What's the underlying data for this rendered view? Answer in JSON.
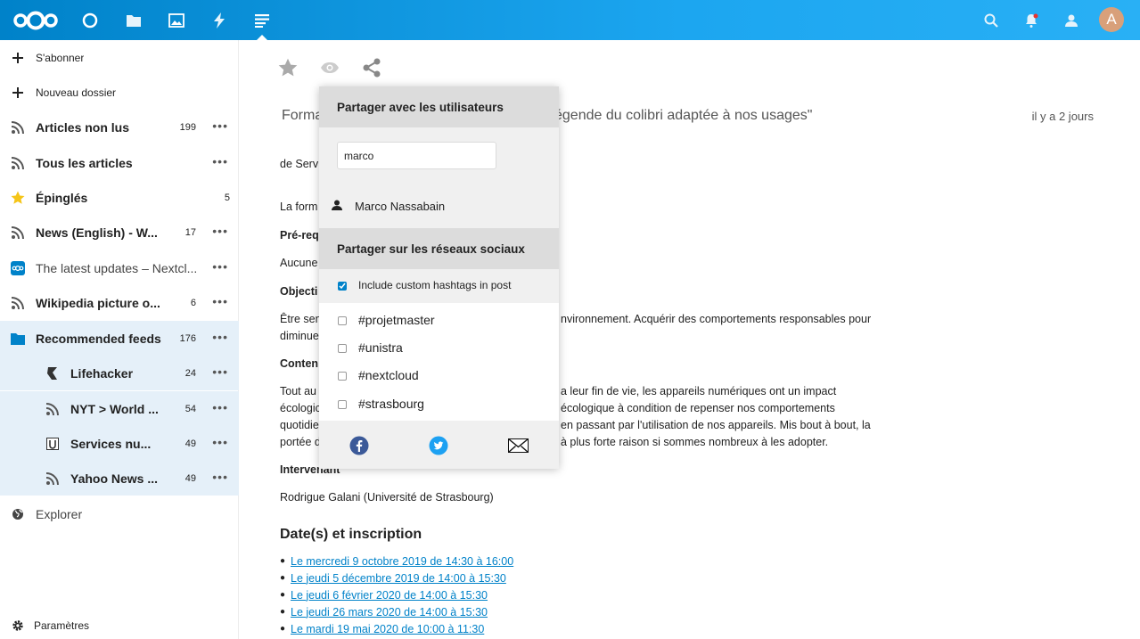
{
  "header": {
    "apps": [
      {
        "name": "logo"
      },
      {
        "name": "dashboard"
      },
      {
        "name": "files"
      },
      {
        "name": "photos"
      },
      {
        "name": "activity"
      },
      {
        "name": "news"
      }
    ],
    "avatar_letter": "A"
  },
  "sidebar": {
    "subscribe": "S'abonner",
    "new_folder": "Nouveau dossier",
    "items": [
      {
        "label": "Articles non lus",
        "count": "199"
      },
      {
        "label": "Tous les articles",
        "count": ""
      },
      {
        "label": "Épinglés",
        "count": "5"
      },
      {
        "label": "News (English) - W...",
        "count": "17"
      },
      {
        "label": "The latest updates – Nextcl...",
        "count": ""
      },
      {
        "label": "Wikipedia picture o...",
        "count": "6"
      },
      {
        "label": "Recommended feeds",
        "count": "176"
      }
    ],
    "subfeeds": [
      {
        "label": "Lifehacker",
        "count": "24"
      },
      {
        "label": "NYT > World ...",
        "count": "54"
      },
      {
        "label": "Services nu...",
        "count": "49"
      },
      {
        "label": "Yahoo News ...",
        "count": "49"
      }
    ],
    "explore": "Explorer",
    "settings": "Paramètres"
  },
  "article": {
    "title_start": "Forma",
    "title_end": "égende du colibri adaptée à nos usages\"",
    "time": "il y a 2 jours",
    "author": "de Serv",
    "p1": "La form",
    "h_prereq": "Pré-req",
    "p_prereq": "Aucune",
    "h_obj": "Objecti",
    "obj_line1_a": "Être sen",
    "obj_line1_b": "nvironnement. Acquérir des comportements responsables pour",
    "obj_line2": "diminue",
    "h_content": "Conten",
    "c1a": "Tout au",
    "c1b": "a leur fin de vie, les appareils numériques ont un impact",
    "c2a": "écologic",
    "c2b": "écologique à condition de repenser nos comportements",
    "c3a": "quotidie",
    "c3b": "en passant par l'utilisation de nos appareils. Mis bout à bout, la",
    "c4a": "portée d",
    "c4b": "à plus forte raison si sommes nombreux à les adopter.",
    "h_speaker": "Intervenant",
    "speaker": "Rodrigue Galani (Université de Strasbourg)",
    "h_dates": "Date(s) et inscription",
    "dates": [
      "Le mercredi 9 octobre 2019 de 14:30 à 16:00",
      "Le jeudi 5 décembre 2019 de 14:00 à 15:30",
      "Le jeudi 6 février 2020 de 14:00 à 15:30",
      "Le jeudi 26 mars 2020 de 14:00 à 15:30",
      "Le mardi 19 mai 2020 de 10:00 à 11:30"
    ]
  },
  "share": {
    "users_title": "Partager avec les utilisateurs",
    "search_value": "marco",
    "user_result": "Marco Nassabain",
    "social_title": "Partager sur les réseaux sociaux",
    "include_hashtags": "Include custom hashtags in post",
    "hashtags": [
      "#projetmaster",
      "#unistra",
      "#nextcloud",
      "#strasbourg"
    ]
  },
  "colors": {
    "brand": "#0082c9",
    "twitter": "#1da1f2",
    "facebook": "#3b5998"
  }
}
